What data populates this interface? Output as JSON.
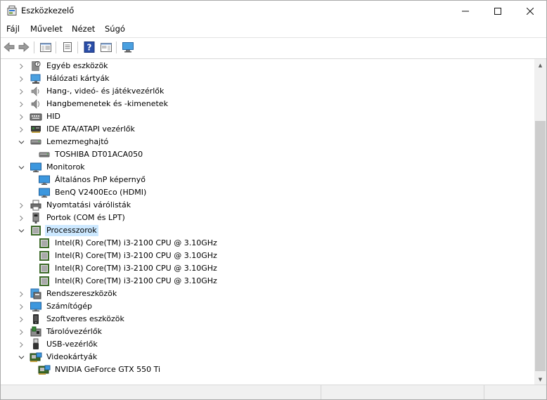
{
  "window": {
    "title": "Eszközkezelő"
  },
  "titlebar_buttons": {
    "minimize": "—",
    "maximize": "☐",
    "close": "✕"
  },
  "menu": [
    "Fájl",
    "Művelet",
    "Nézet",
    "Súgó"
  ],
  "tree": [
    {
      "label": "Egyéb eszközök",
      "icon": "other-devices-icon",
      "level": 0,
      "expander": "collapsed"
    },
    {
      "label": "Hálózati kártyák",
      "icon": "network-adapter-icon",
      "level": 0,
      "expander": "collapsed"
    },
    {
      "label": "Hang-, videó- és játékvezérlők",
      "icon": "speaker-icon",
      "level": 0,
      "expander": "collapsed"
    },
    {
      "label": "Hangbemenetek és -kimenetek",
      "icon": "audio-io-icon",
      "level": 0,
      "expander": "collapsed"
    },
    {
      "label": "HID",
      "icon": "keyboard-icon",
      "level": 0,
      "expander": "collapsed"
    },
    {
      "label": "IDE ATA/ATAPI vezérlők",
      "icon": "ide-controller-icon",
      "level": 0,
      "expander": "collapsed"
    },
    {
      "label": "Lemezmeghajtó",
      "icon": "disk-drive-icon",
      "level": 0,
      "expander": "expanded"
    },
    {
      "label": "TOSHIBA DT01ACA050",
      "icon": "disk-drive-icon",
      "level": 1,
      "expander": "none"
    },
    {
      "label": "Monitorok",
      "icon": "monitor-icon",
      "level": 0,
      "expander": "expanded"
    },
    {
      "label": "Általános PnP képernyő",
      "icon": "monitor-icon",
      "level": 1,
      "expander": "none"
    },
    {
      "label": "BenQ V2400Eco (HDMI)",
      "icon": "monitor-icon",
      "level": 1,
      "expander": "none"
    },
    {
      "label": "Nyomtatási várólisták",
      "icon": "printer-icon",
      "level": 0,
      "expander": "collapsed"
    },
    {
      "label": "Portok (COM és LPT)",
      "icon": "port-icon",
      "level": 0,
      "expander": "collapsed"
    },
    {
      "label": "Processzorok",
      "icon": "processor-icon",
      "level": 0,
      "expander": "expanded",
      "selected": true
    },
    {
      "label": "Intel(R) Core(TM) i3-2100 CPU @ 3.10GHz",
      "icon": "processor-icon",
      "level": 1,
      "expander": "none"
    },
    {
      "label": "Intel(R) Core(TM) i3-2100 CPU @ 3.10GHz",
      "icon": "processor-icon",
      "level": 1,
      "expander": "none"
    },
    {
      "label": "Intel(R) Core(TM) i3-2100 CPU @ 3.10GHz",
      "icon": "processor-icon",
      "level": 1,
      "expander": "none"
    },
    {
      "label": "Intel(R) Core(TM) i3-2100 CPU @ 3.10GHz",
      "icon": "processor-icon",
      "level": 1,
      "expander": "none"
    },
    {
      "label": "Rendszereszközök",
      "icon": "system-devices-icon",
      "level": 0,
      "expander": "collapsed"
    },
    {
      "label": "Számítógép",
      "icon": "computer-icon",
      "level": 0,
      "expander": "collapsed"
    },
    {
      "label": "Szoftveres eszközök",
      "icon": "software-device-icon",
      "level": 0,
      "expander": "collapsed"
    },
    {
      "label": "Tárolóvezérlők",
      "icon": "storage-controller-icon",
      "level": 0,
      "expander": "collapsed"
    },
    {
      "label": "USB-vezérlők",
      "icon": "usb-icon",
      "level": 0,
      "expander": "collapsed"
    },
    {
      "label": "Videokártyák",
      "icon": "display-adapter-icon",
      "level": 0,
      "expander": "expanded"
    },
    {
      "label": "NVIDIA GeForce GTX 550 Ti",
      "icon": "display-adapter-icon",
      "level": 1,
      "expander": "none"
    }
  ],
  "colors": {
    "selection": "#cce8ff",
    "scrollbar_thumb": "#cdcdcd"
  }
}
